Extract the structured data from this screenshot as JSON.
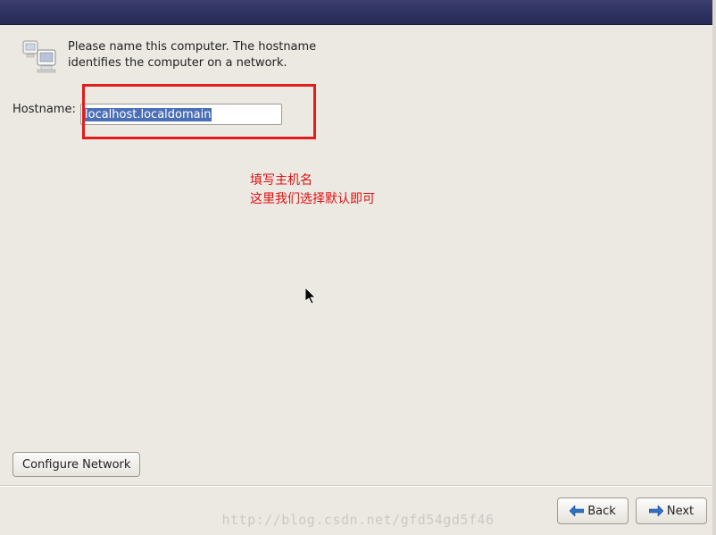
{
  "header": {
    "instruction": "Please name this computer.  The hostname identifies the computer on a network."
  },
  "hostname": {
    "label": "Hostname:",
    "value": "localhost.localdomain"
  },
  "annotation": {
    "line1": "填写主机名",
    "line2": "这里我们选择默认即可"
  },
  "buttons": {
    "configure_network": "Configure Network",
    "back": "Back",
    "next": "Next"
  },
  "watermark": "http://blog.csdn.net/gfd54gd5f46"
}
